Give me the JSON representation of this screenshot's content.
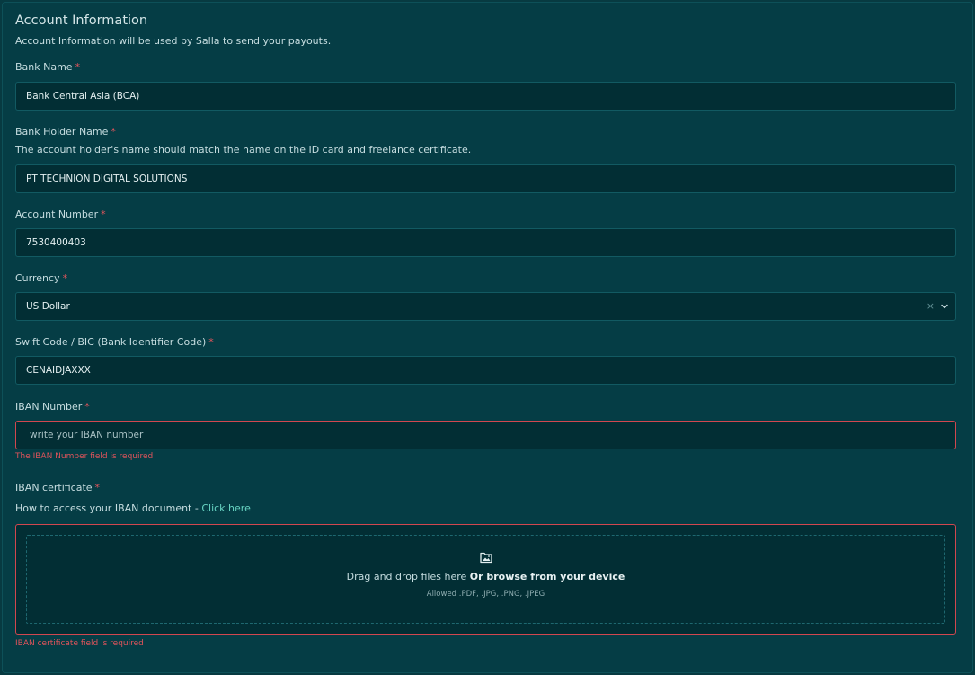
{
  "section": {
    "title": "Account Information",
    "subtitle": "Account Information will be used by Salla to send your payouts."
  },
  "required_mark": "*",
  "bank_name": {
    "label": "Bank Name",
    "value": "Bank Central Asia (BCA)"
  },
  "holder_name": {
    "label": "Bank Holder Name",
    "hint": "The account holder's name should match the name on the ID card and freelance certificate.",
    "value": "PT TECHNION DIGITAL SOLUTIONS"
  },
  "account_number": {
    "label": "Account Number",
    "value": "7530400403"
  },
  "currency": {
    "label": "Currency",
    "value": "US Dollar",
    "clear_symbol": "×"
  },
  "swift": {
    "label": "Swift Code / BIC (Bank Identifier Code)",
    "value": "CENAIDJAXXX"
  },
  "iban": {
    "label": "IBAN Number",
    "value": "",
    "placeholder": "write your IBAN number",
    "error": "The IBAN Number field is required"
  },
  "iban_certificate": {
    "label": "IBAN certificate",
    "help_text": "How to access your IBAN document - ",
    "help_link": "Click here",
    "drop_text": "Drag and drop files here ",
    "browse_text": "Or browse from your device",
    "allowed": "Allowed .PDF, .JPG, .PNG, .JPEG",
    "error": "IBAN certificate field is required"
  },
  "colors": {
    "background": "#053d45",
    "field_bg": "#022e34",
    "accent_link": "#67d3c2",
    "error": "#d2474f"
  }
}
